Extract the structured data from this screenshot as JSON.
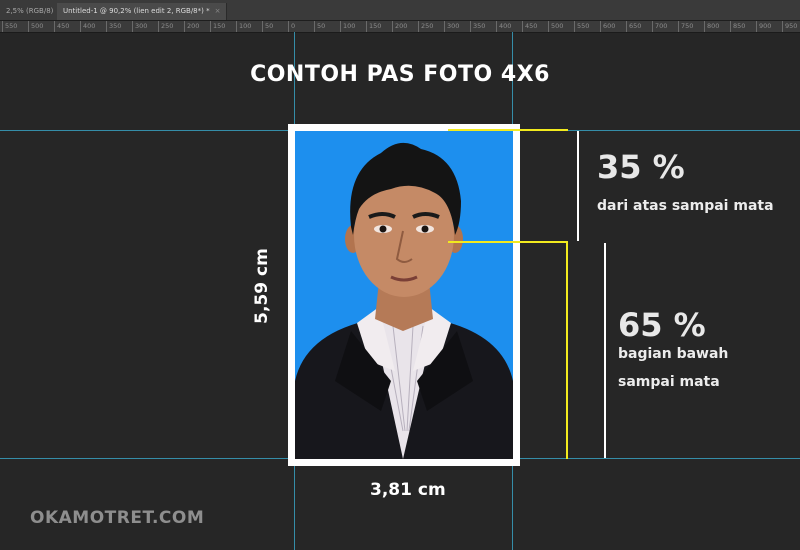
{
  "tabs": [
    {
      "label": "2,5% (RGB/8)",
      "close": "×"
    },
    {
      "label": "Untitled-1 @ 90,2% (lien edit 2, RGB/8*) *",
      "close": "×"
    }
  ],
  "ruler": {
    "ticks": [
      "550",
      "500",
      "450",
      "400",
      "350",
      "300",
      "250",
      "200",
      "150",
      "100",
      "50",
      "0",
      "50",
      "100",
      "150",
      "200",
      "250",
      "300",
      "350",
      "400",
      "450",
      "500",
      "550",
      "600",
      "650",
      "700",
      "750",
      "800",
      "850",
      "900",
      "950"
    ]
  },
  "title": "CONTOH PAS FOTO 4X6",
  "top_section": {
    "percent": "35 %",
    "label": "dari atas sampai mata"
  },
  "bottom_section": {
    "percent": "65 %",
    "label_line1": "bagian bawah",
    "label_line2": "sampai mata"
  },
  "dimensions": {
    "height": "5,59 cm",
    "width": "3,81 cm"
  },
  "watermark": "OKAMOTRET.COM",
  "colors": {
    "background": "#262626",
    "photo_bg": "#1d8fee",
    "guide": "#3aa8c9",
    "measure_line": "#f2ea1e"
  }
}
